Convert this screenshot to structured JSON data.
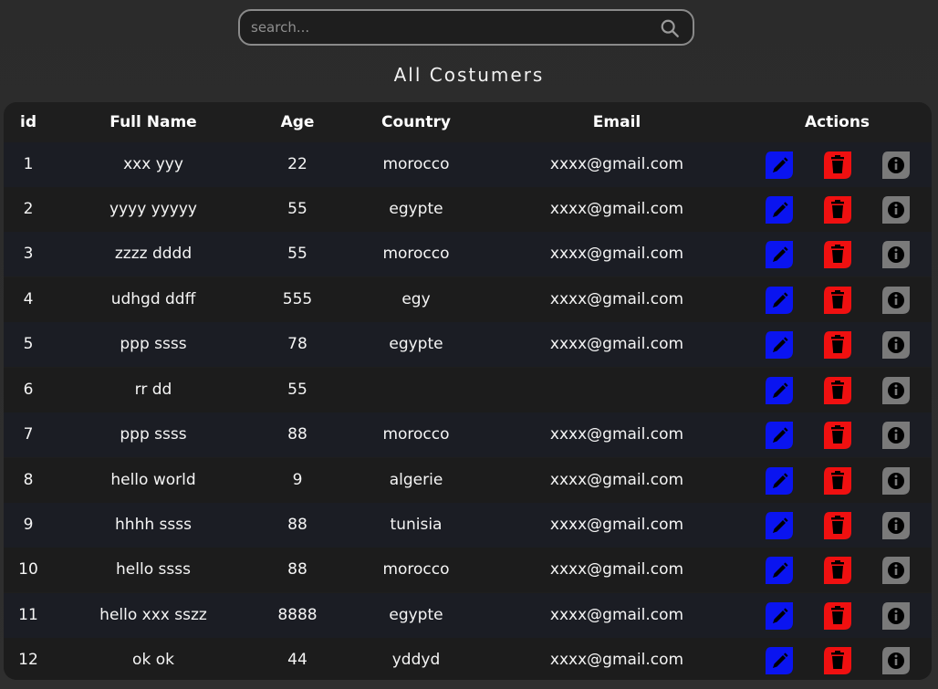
{
  "search": {
    "placeholder": "search...",
    "icon": "search-icon"
  },
  "page_title": "All Costumers",
  "table": {
    "headers": {
      "id": "id",
      "full_name": "Full Name",
      "age": "Age",
      "country": "Country",
      "email": "Email",
      "actions": "Actions"
    },
    "rows": [
      {
        "id": "1",
        "full_name": "xxx yyy",
        "age": "22",
        "country": "morocco",
        "email": "xxxx@gmail.com"
      },
      {
        "id": "2",
        "full_name": "yyyy yyyyy",
        "age": "55",
        "country": "egypte",
        "email": "xxxx@gmail.com"
      },
      {
        "id": "3",
        "full_name": "zzzz dddd",
        "age": "55",
        "country": "morocco",
        "email": "xxxx@gmail.com"
      },
      {
        "id": "4",
        "full_name": "udhgd ddff",
        "age": "555",
        "country": "egy",
        "email": "xxxx@gmail.com"
      },
      {
        "id": "5",
        "full_name": "ppp ssss",
        "age": "78",
        "country": "egypte",
        "email": "xxxx@gmail.com"
      },
      {
        "id": "6",
        "full_name": "rr dd",
        "age": "55",
        "country": "",
        "email": ""
      },
      {
        "id": "7",
        "full_name": "ppp ssss",
        "age": "88",
        "country": "morocco",
        "email": "xxxx@gmail.com"
      },
      {
        "id": "8",
        "full_name": "hello world",
        "age": "9",
        "country": "algerie",
        "email": "xxxx@gmail.com"
      },
      {
        "id": "9",
        "full_name": "hhhh ssss",
        "age": "88",
        "country": "tunisia",
        "email": "xxxx@gmail.com"
      },
      {
        "id": "10",
        "full_name": "hello ssss",
        "age": "88",
        "country": "morocco",
        "email": "xxxx@gmail.com"
      },
      {
        "id": "11",
        "full_name": "hello xxx sszz",
        "age": "8888",
        "country": "egypte",
        "email": "xxxx@gmail.com"
      },
      {
        "id": "12",
        "full_name": "ok ok",
        "age": "44",
        "country": "yddyd",
        "email": "xxxx@gmail.com"
      }
    ],
    "actions": [
      {
        "name": "edit",
        "icon": "pencil-icon",
        "color": "#0a14f0"
      },
      {
        "name": "delete",
        "icon": "trash-icon",
        "color": "#f01010"
      },
      {
        "name": "info",
        "icon": "info-icon",
        "color": "#7a7a7a"
      }
    ]
  },
  "colors": {
    "background": "#2b2b2b",
    "table_background": "#1e1e1e",
    "row_alt": "#1b1d24",
    "edit": "#0a14f0",
    "delete": "#f01010",
    "info": "#7a7a7a"
  }
}
